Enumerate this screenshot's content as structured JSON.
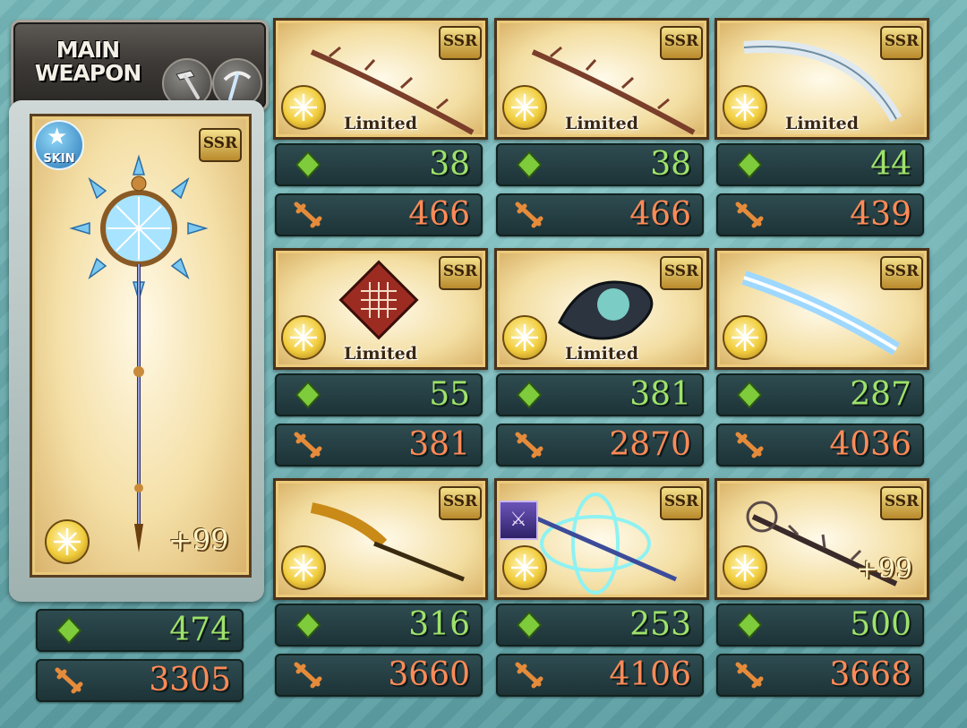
{
  "header": {
    "title_line1": "MAIN",
    "title_line2": "WEAPON",
    "icons": [
      "hammer-icon",
      "pickaxe-icon"
    ]
  },
  "main_weapon": {
    "rarity": "SSR",
    "skin_label": "SKIN",
    "plus": "+99",
    "hp": "474",
    "atk": "3305",
    "icon": "ice-staff-icon"
  },
  "grid": [
    {
      "rarity": "SSR",
      "tag": "Limited",
      "plus": "",
      "hp": "38",
      "atk": "466",
      "icon": "bone-spear-icon"
    },
    {
      "rarity": "SSR",
      "tag": "Limited",
      "plus": "",
      "hp": "38",
      "atk": "466",
      "icon": "bone-spear-icon"
    },
    {
      "rarity": "SSR",
      "tag": "Limited",
      "plus": "",
      "hp": "44",
      "atk": "439",
      "icon": "curved-blade-icon"
    },
    {
      "rarity": "SSR",
      "tag": "Limited",
      "plus": "",
      "hp": "55",
      "atk": "381",
      "icon": "knot-emblem-icon"
    },
    {
      "rarity": "SSR",
      "tag": "Limited",
      "plus": "",
      "hp": "381",
      "atk": "2870",
      "icon": "dark-orb-icon"
    },
    {
      "rarity": "SSR",
      "tag": "",
      "plus": "",
      "hp": "287",
      "atk": "4036",
      "icon": "ice-sword-icon"
    },
    {
      "rarity": "SSR",
      "tag": "",
      "plus": "",
      "hp": "316",
      "atk": "3660",
      "icon": "golden-glaive-icon"
    },
    {
      "rarity": "SSR",
      "tag": "",
      "plus": "",
      "hp": "253",
      "atk": "4106",
      "icon": "crystal-lance-icon",
      "skill_icon": "crossed-swords-icon"
    },
    {
      "rarity": "SSR",
      "tag": "",
      "plus": "+99",
      "hp": "500",
      "atk": "3668",
      "icon": "thorn-staff-icon"
    }
  ],
  "colors": {
    "hp_text": "#9ee26a",
    "atk_text": "#ff8a57",
    "bar_bg": "#1c3236",
    "card_gold": "#f3dea2"
  }
}
